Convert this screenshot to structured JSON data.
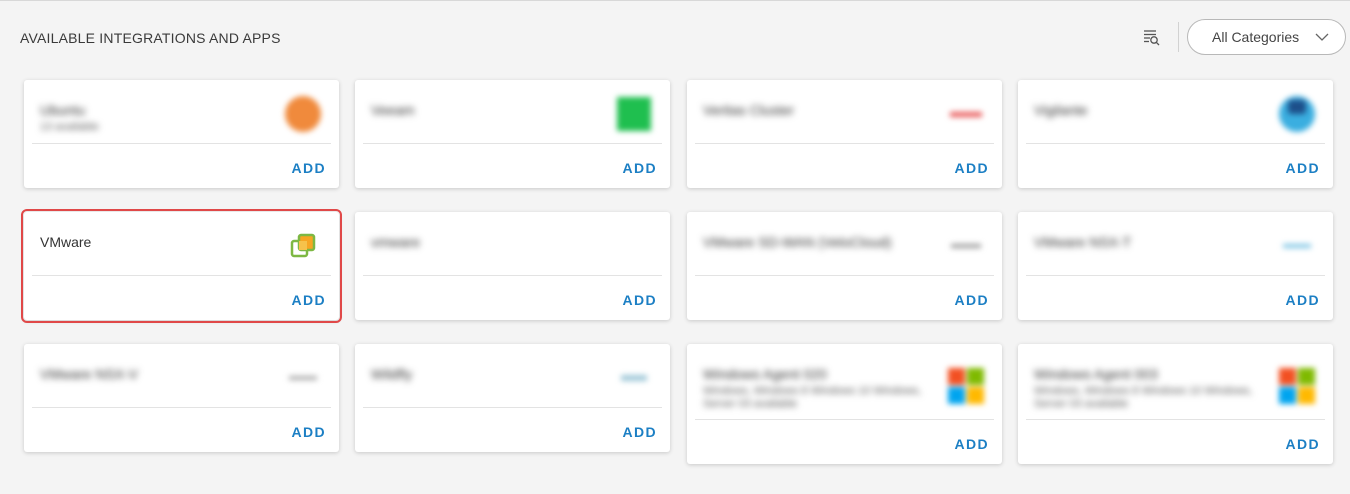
{
  "header": {
    "title": "AVAILABLE INTEGRATIONS AND APPS",
    "category_dropdown": "All Categories"
  },
  "cards": [
    {
      "name": "Ubuntu",
      "sub": "13 available",
      "logo": "ubuntu-logo",
      "add": "ADD",
      "blurred": true
    },
    {
      "name": "Veeam",
      "sub": "",
      "logo": "veeam-logo",
      "add": "ADD",
      "blurred": true
    },
    {
      "name": "Veritas Cluster",
      "sub": "",
      "logo": "veritas-logo",
      "add": "ADD",
      "blurred": true
    },
    {
      "name": "Vigilante",
      "sub": "",
      "logo": "vigilante-logo",
      "add": "ADD",
      "blurred": true
    },
    {
      "name": "VMware",
      "sub": "",
      "logo": "vmware-logo",
      "add": "ADD",
      "blurred": false,
      "selected": true
    },
    {
      "name": "vmware",
      "sub": "",
      "logo": "",
      "add": "ADD",
      "blurred": true
    },
    {
      "name": "VMware SD-WAN (VeloCloud)",
      "sub": "",
      "logo": "vmware-sdwan-logo",
      "add": "ADD",
      "blurred": true
    },
    {
      "name": "VMware NSX-T",
      "sub": "",
      "logo": "vmware-nsxt-logo",
      "add": "ADD",
      "blurred": true
    },
    {
      "name": "VMware NSX-V",
      "sub": "",
      "logo": "vmware-nsxv-logo",
      "add": "ADD",
      "blurred": true
    },
    {
      "name": "Wildfly",
      "sub": "",
      "logo": "wildfly-logo",
      "add": "ADD",
      "blurred": true
    },
    {
      "name": "Windows Agent 020",
      "sub": "Windows, Windows 8 Windows 10 Windows, Server 03 available",
      "logo": "windows-logo",
      "add": "ADD",
      "blurred": true
    },
    {
      "name": "Windows Agent 003",
      "sub": "Windows, Windows 8 Windows 10 Windows, Server 03 available",
      "logo": "windows-logo",
      "add": "ADD",
      "blurred": true
    }
  ],
  "colors": {
    "accent": "#1c7fc4",
    "selection": "#e04848",
    "background": "#f4f4f4"
  }
}
